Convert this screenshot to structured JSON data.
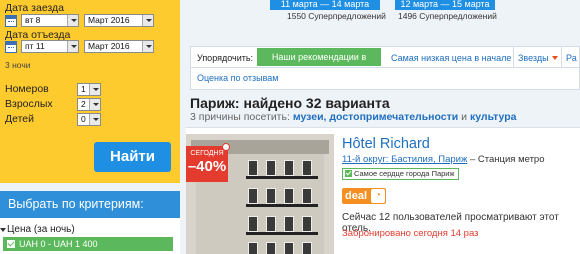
{
  "search": {
    "checkin_label": "Дата заезда",
    "checkin_day": "вт 8",
    "checkin_month": "Март 2016",
    "checkout_label": "Дата отъезда",
    "checkout_day": "пт 11",
    "checkout_month": "Март 2016",
    "nights": "3 ночи",
    "rooms_label": "Номеров",
    "rooms_value": "1",
    "adults_label": "Взрослых",
    "adults_value": "2",
    "children_label": "Детей",
    "children_value": "0",
    "search_button": "Найти"
  },
  "criteria": {
    "header": "Выбрать по критериям:",
    "price_label": "Цена (за ночь)",
    "price_range": "UAH 0 - UAH 1 400"
  },
  "date_banners": [
    {
      "dates": "11 марта — 14 марта",
      "deals": "1550 Суперпредложений"
    },
    {
      "dates": "12 марта — 15 марта",
      "deals": "1496 Суперпредложений"
    }
  ],
  "sort": {
    "label": "Упорядочить:",
    "active": "Наши рекомендации в начале",
    "lowest_price": "Самая низкая цена в начале",
    "stars": "Звезды",
    "distance": "Ра",
    "review_score": "Оценка по отзывам"
  },
  "results": {
    "title": "Париж: найдено 32 варианта",
    "reasons_prefix": "3 причины посетить:",
    "reason_1": "музеи",
    "reason_2": "достопримечательности",
    "reason_join": "и",
    "reason_3": "культура"
  },
  "hotel": {
    "badge_top": "СЕГОДНЯ",
    "badge_discount": "–40%",
    "name": "Hôtel Richard",
    "district_link": "11-й округ: Бастилия, Париж",
    "district_suffix": " – Станция метро",
    "heart_tag": "Самое сердце города Париж",
    "deal_label": "deal",
    "watching": "Сейчас 12 пользователей просматривают этот отель.",
    "booked": "Забронировано сегодня 14 раз"
  },
  "colors": {
    "search_panel": "#fecb2f",
    "primary_blue": "#1f8fe4",
    "active_green": "#5cb85c",
    "discount_red": "#e33b2e",
    "deal_orange": "#f39021"
  }
}
